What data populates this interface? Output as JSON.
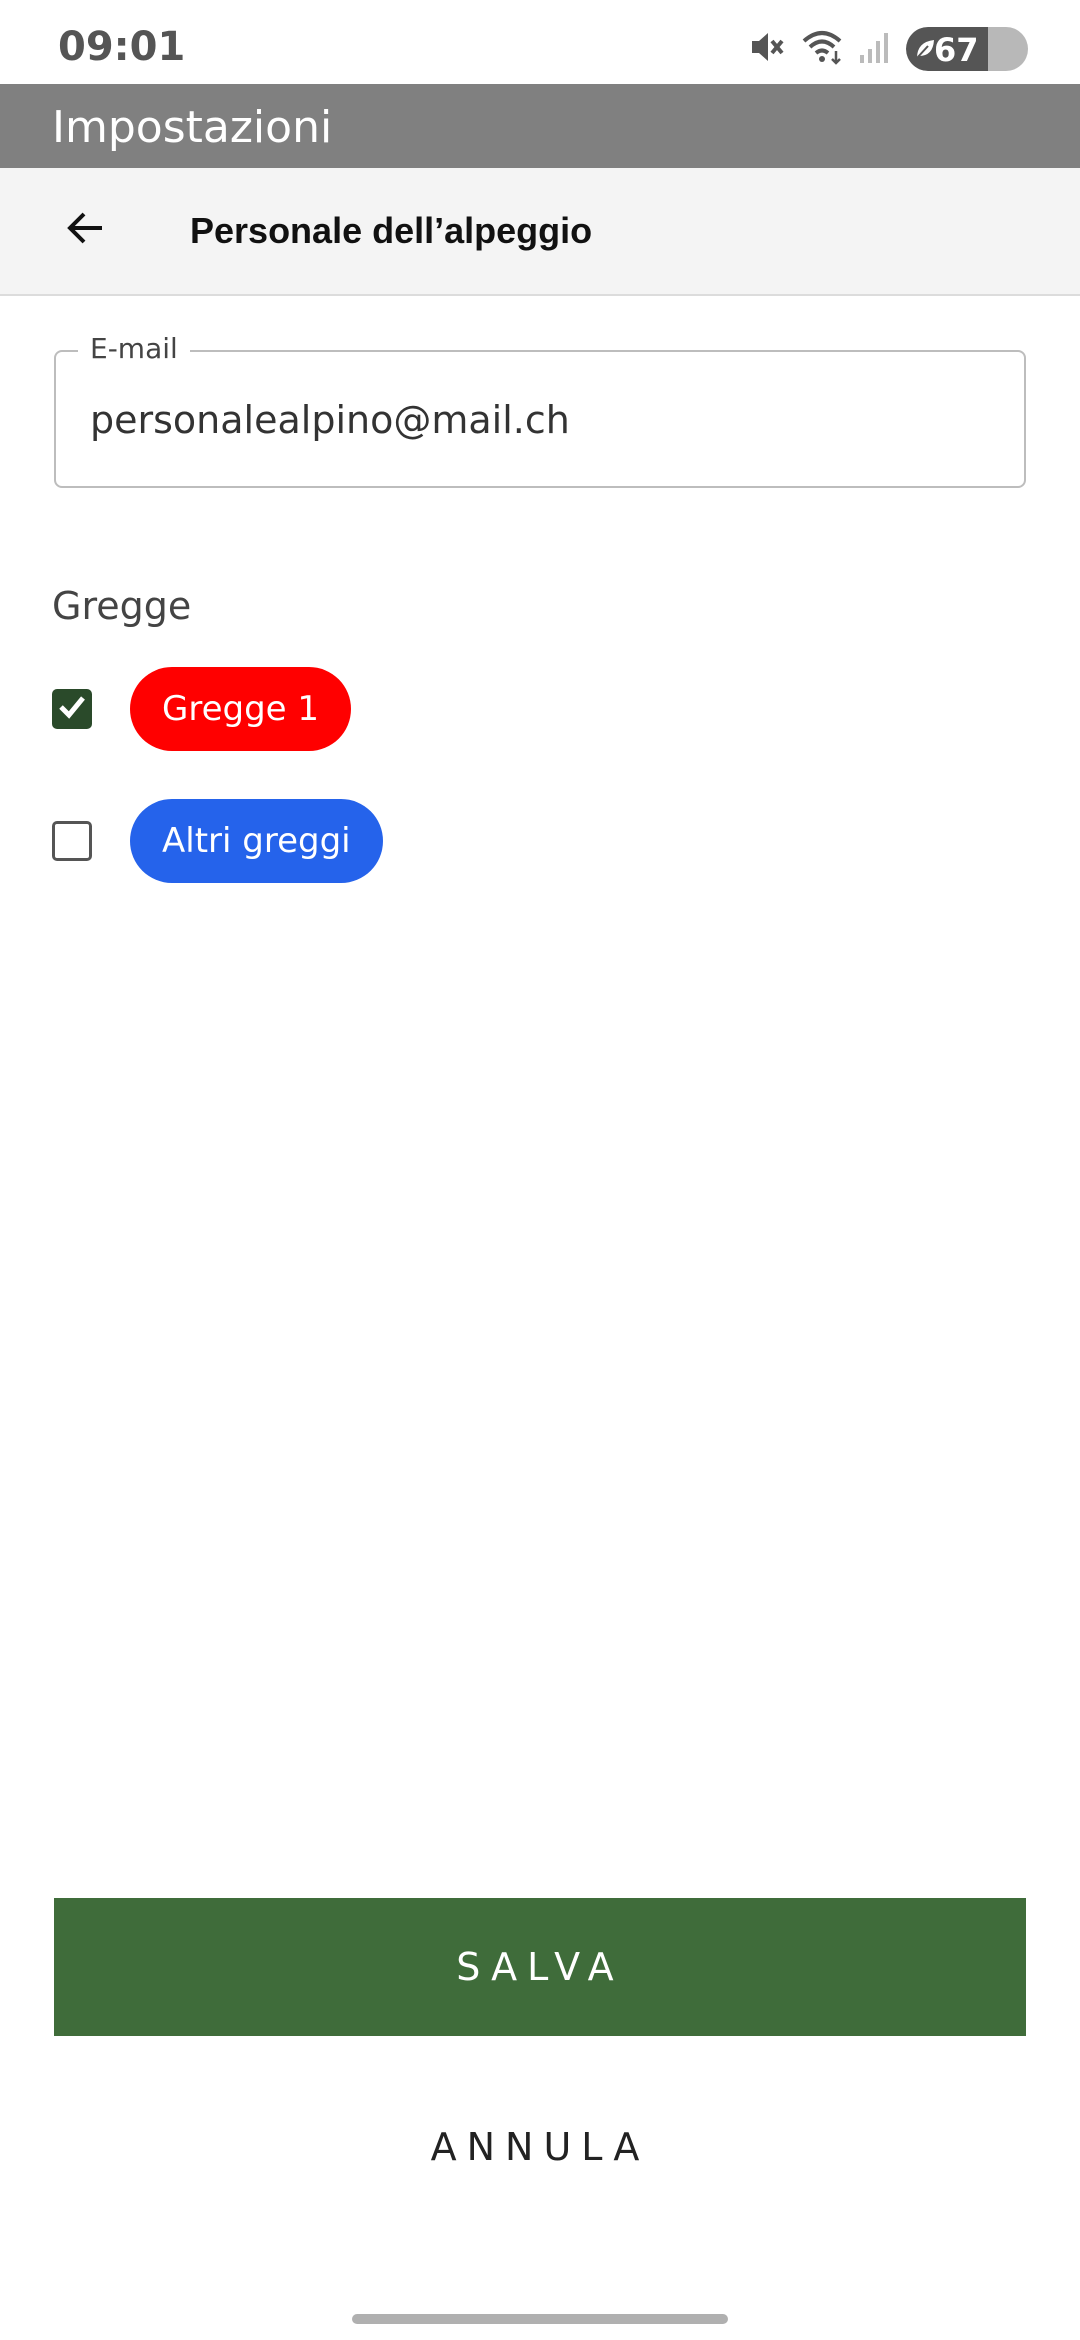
{
  "status_bar": {
    "time": "09:01",
    "battery_level": "67",
    "battery_fraction": 0.67,
    "icons": [
      "mute-icon",
      "wifi-icon",
      "signal-icon",
      "battery-icon"
    ]
  },
  "app_bar": {
    "title": "Impostazioni"
  },
  "page_header": {
    "title": "Personale dell’alpeggio",
    "back_icon": "arrow-left-icon"
  },
  "email": {
    "label": "E-mail",
    "value": "personalealpino@mail.ch"
  },
  "flocks": {
    "title": "Gregge",
    "items": [
      {
        "label": "Gregge 1",
        "checked": true,
        "color": "#ff0000"
      },
      {
        "label": "Altri greggi",
        "checked": false,
        "color": "#2563eb"
      }
    ]
  },
  "actions": {
    "save_label": "SALVA",
    "cancel_label": "ANNULA"
  },
  "colors": {
    "app_bar": "#808080",
    "save_button": "#3f6c3a",
    "checkbox_checked": "#2a4a2a"
  }
}
